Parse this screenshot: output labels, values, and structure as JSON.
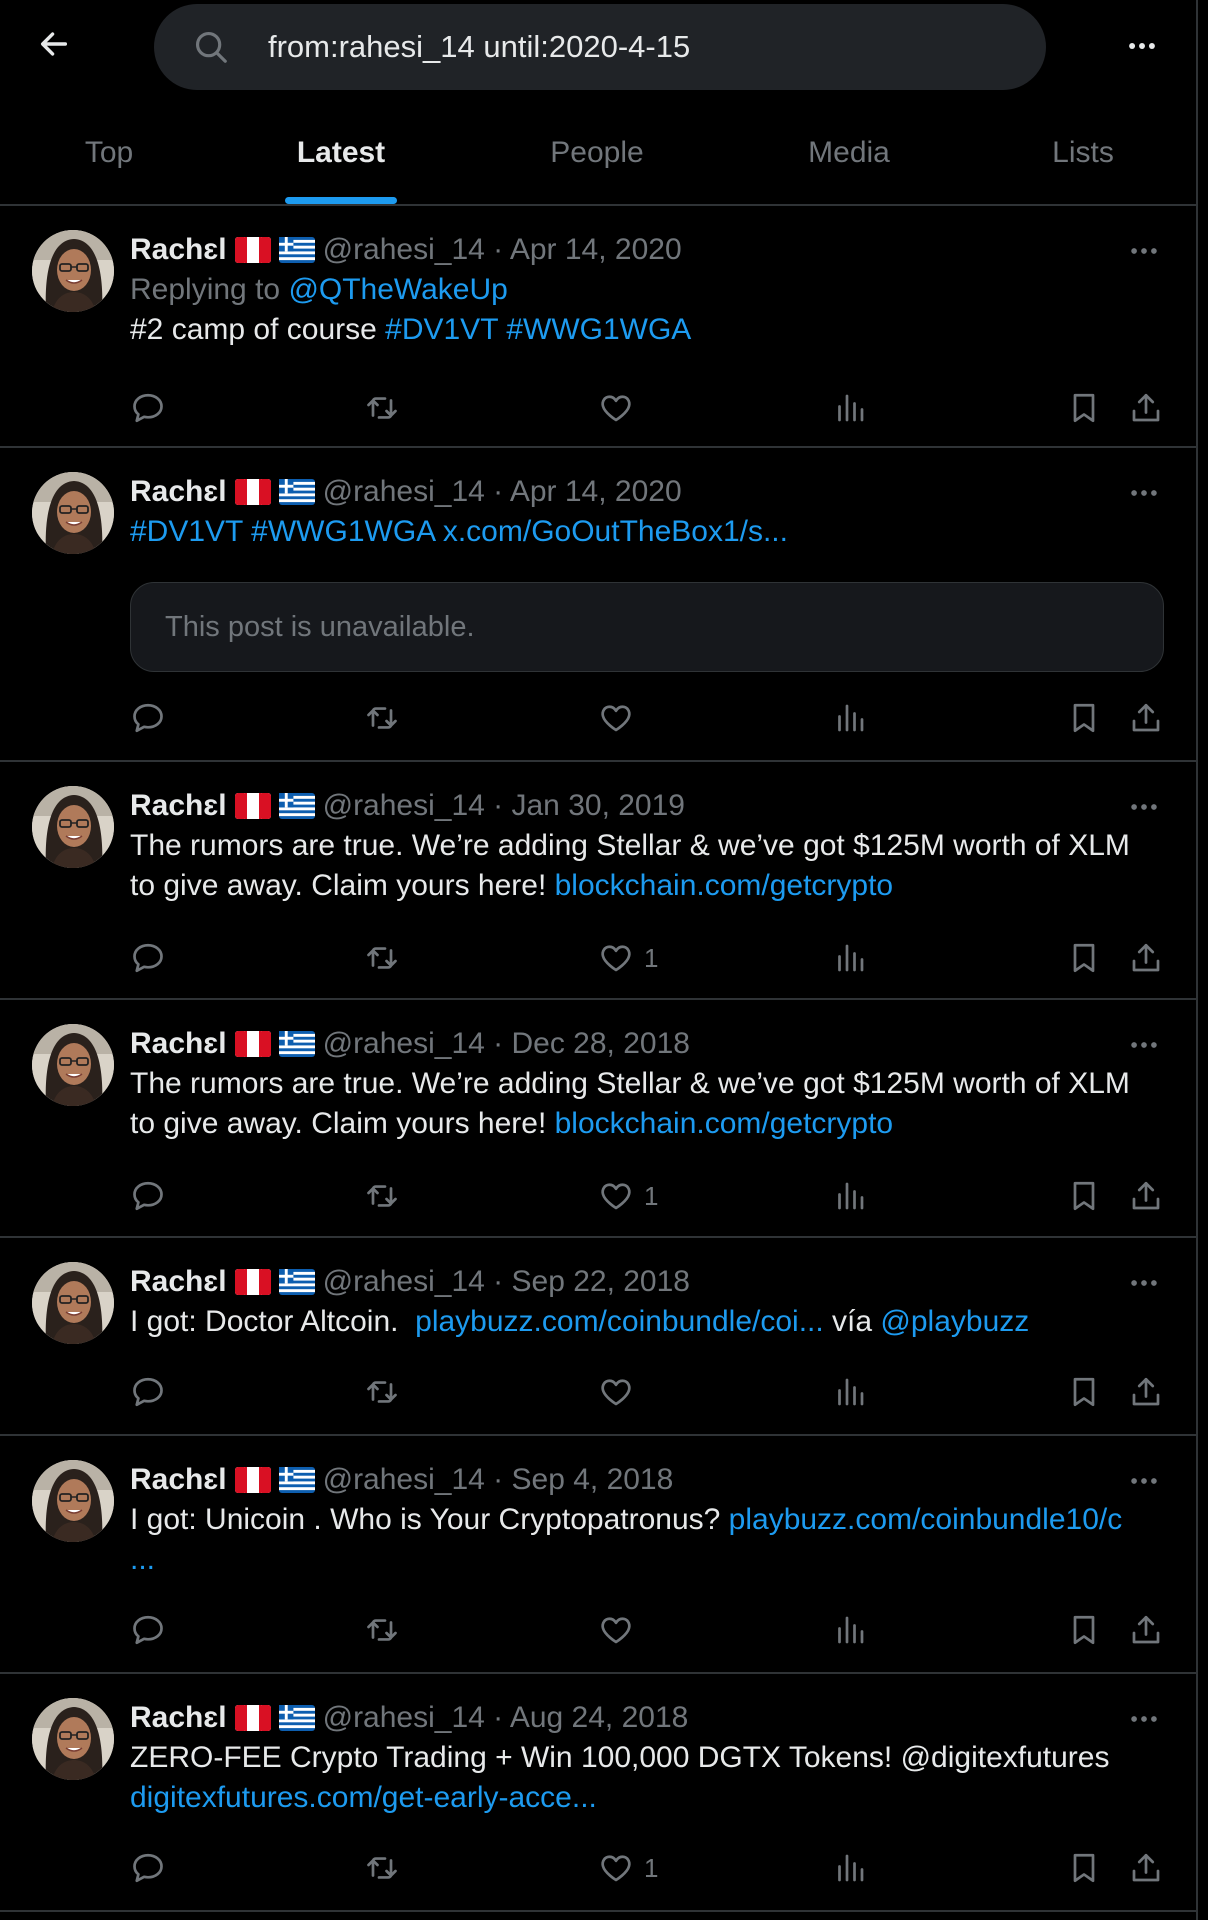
{
  "search": {
    "query": "from:rahesi_14 until:2020-4-15"
  },
  "tabs": [
    {
      "label": "Top",
      "active": false
    },
    {
      "label": "Latest",
      "active": true
    },
    {
      "label": "People",
      "active": false
    },
    {
      "label": "Media",
      "active": false
    },
    {
      "label": "Lists",
      "active": false
    }
  ],
  "colors": {
    "accent": "#1d9bf0",
    "muted": "#71767b",
    "background": "#000000"
  },
  "posts": [
    {
      "name": "Rachɛl",
      "handle": "@rahesi_14",
      "date": "· Apr 14, 2020",
      "reply_prefix": "Replying to ",
      "reply_to": "@QTheWakeUp",
      "text": "#2 camp of course ",
      "hashtags": "#DV1VT #WWG1WGA"
    },
    {
      "name": "Rachɛl",
      "handle": "@rahesi_14",
      "date": "· Apr 14, 2020",
      "link_text": "#DV1VT #WWG1WGA x.com/GoOutTheBox1/s...",
      "unavailable": "This post is unavailable."
    },
    {
      "name": "Rachɛl",
      "handle": "@rahesi_14",
      "date": "· Jan 30, 2019",
      "text1": "The rumors are true. We’re adding Stellar & we’ve got $125M worth of XLM",
      "text2": "to give away. Claim yours here! ",
      "link": "blockchain.com/getcrypto",
      "likes": "1"
    },
    {
      "name": "Rachɛl",
      "handle": "@rahesi_14",
      "date": "· Dec 28, 2018",
      "text1": "The rumors are true. We’re adding Stellar & we’ve got $125M worth of XLM",
      "text2": "to give away. Claim yours here! ",
      "link": "blockchain.com/getcrypto",
      "likes": "1"
    },
    {
      "name": "Rachɛl",
      "handle": "@rahesi_14",
      "date": "· Sep 22, 2018",
      "text": "I got: Doctor Altcoin.  ",
      "link": "playbuzz.com/coinbundle/coi...",
      "via": " vía ",
      "mention": "@playbuzz"
    },
    {
      "name": "Rachɛl",
      "handle": "@rahesi_14",
      "date": "· Sep 4, 2018",
      "text": "I got: Unicoin . Who is Your Cryptopatronus? ",
      "link": "playbuzz.com/coinbundle10/c",
      "link2": "..."
    },
    {
      "name": "Rachɛl",
      "handle": "@rahesi_14",
      "date": "· Aug 24, 2018",
      "text": "ZERO-FEE Crypto Trading + Win 100,000 DGTX Tokens! @digitexfutures",
      "link": "digitexfutures.com/get-early-acce...",
      "likes": "1"
    }
  ]
}
